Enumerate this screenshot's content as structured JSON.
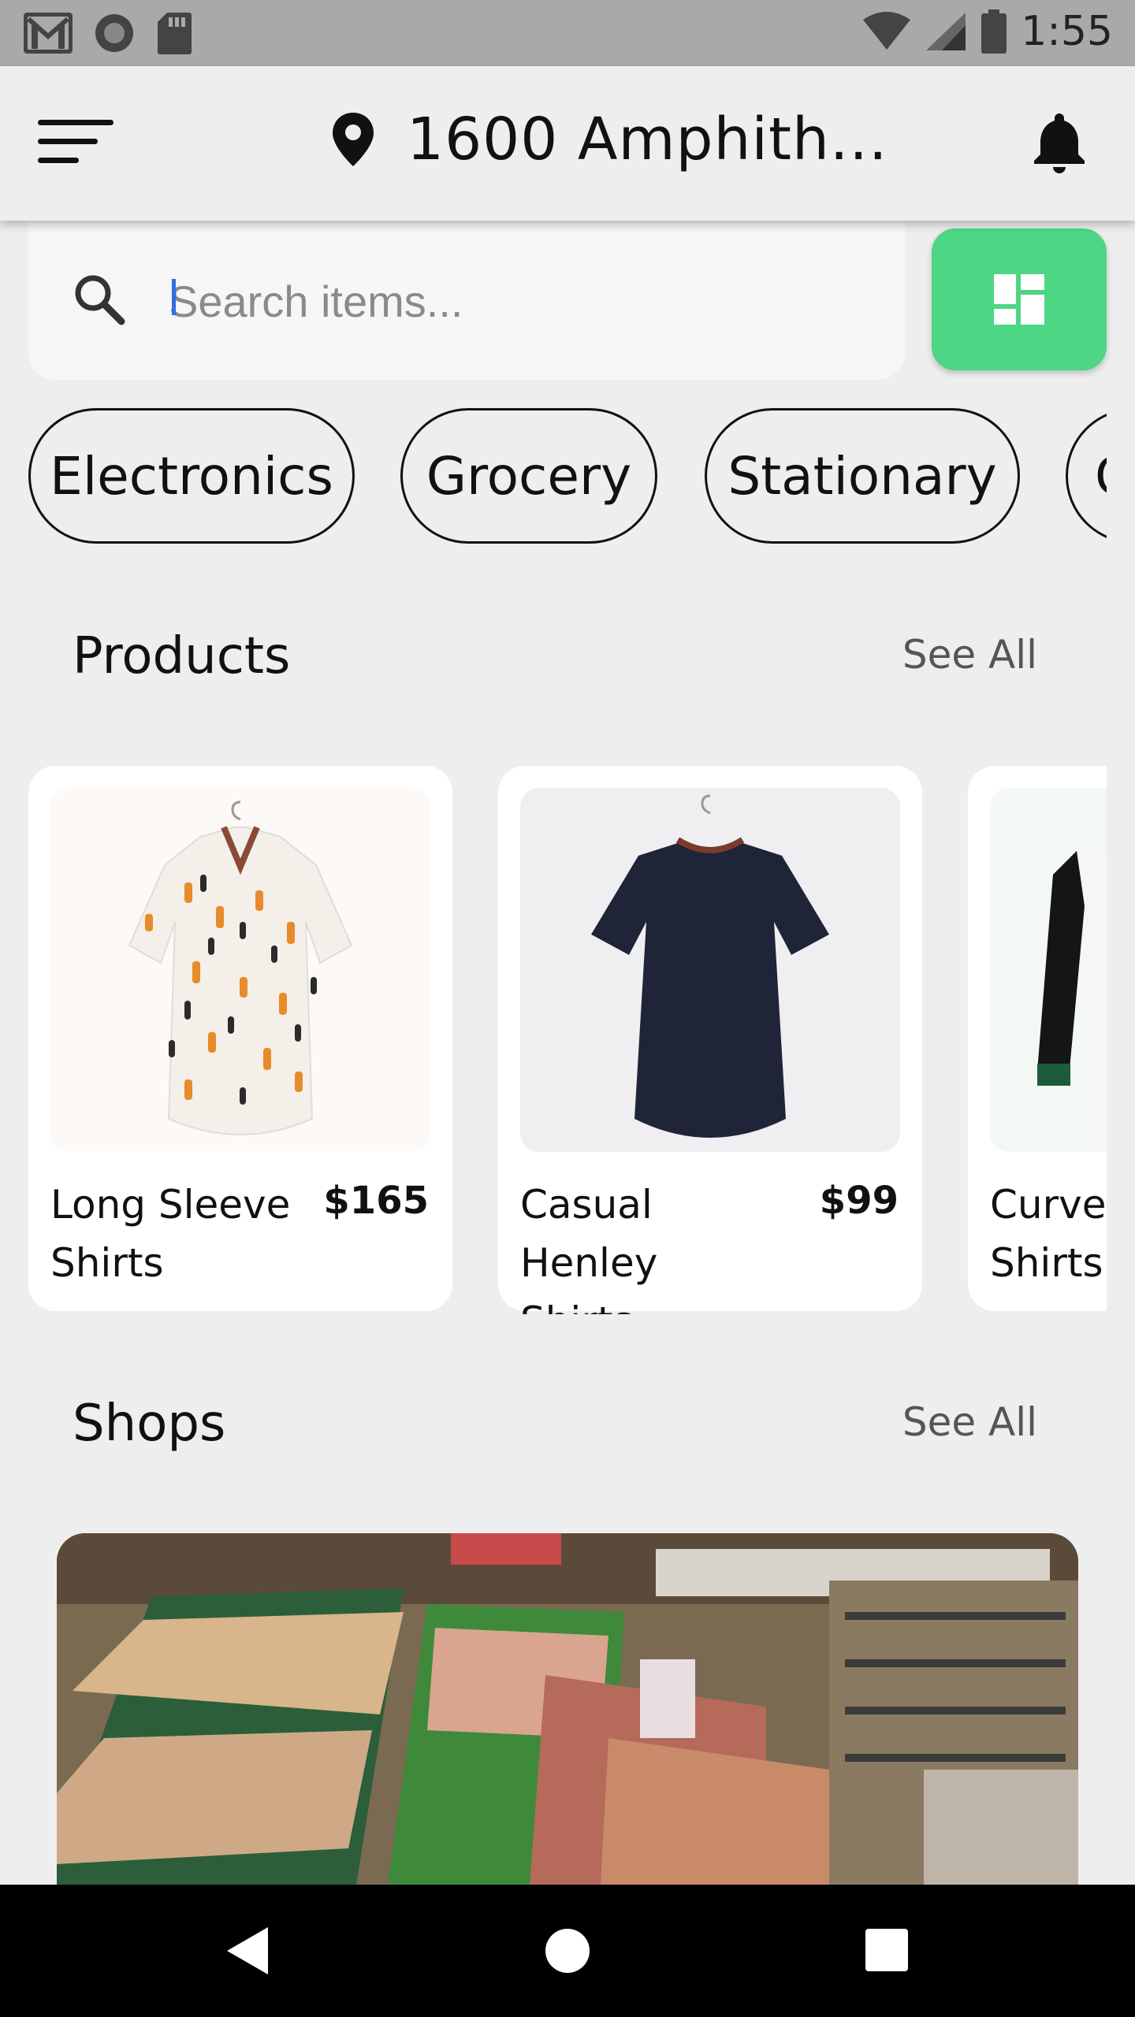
{
  "status_bar": {
    "time": "1:55",
    "left_icons": [
      "gmail-icon",
      "circle-app-icon",
      "sd-card-icon"
    ],
    "right_icons": [
      "wifi-icon",
      "cell-signal-icon",
      "battery-icon"
    ]
  },
  "header": {
    "menu_icon": "hamburger-menu-icon",
    "location_icon": "map-pin-icon",
    "location_text": "1600 Amphith...",
    "notification_icon": "bell-icon"
  },
  "search": {
    "placeholder": "Search items...",
    "value": "",
    "layout_toggle_icon": "dashboard-grid-icon",
    "layout_toggle_color": "#4dd683"
  },
  "categories": [
    "Electronics",
    "Grocery",
    "Stationary",
    "G"
  ],
  "products_section": {
    "title": "Products",
    "see_all": "See All",
    "items": [
      {
        "name": "Long Sleeve Shirts",
        "price": "$165"
      },
      {
        "name": "Casual Henley Shirts",
        "price": "$99"
      },
      {
        "name": "Curved Shirts",
        "price": ""
      }
    ]
  },
  "shops_section": {
    "title": "Shops",
    "see_all": "See All"
  },
  "nav_bar": {
    "back_icon": "back-triangle-icon",
    "home_icon": "home-circle-icon",
    "recents_icon": "recents-square-icon"
  }
}
